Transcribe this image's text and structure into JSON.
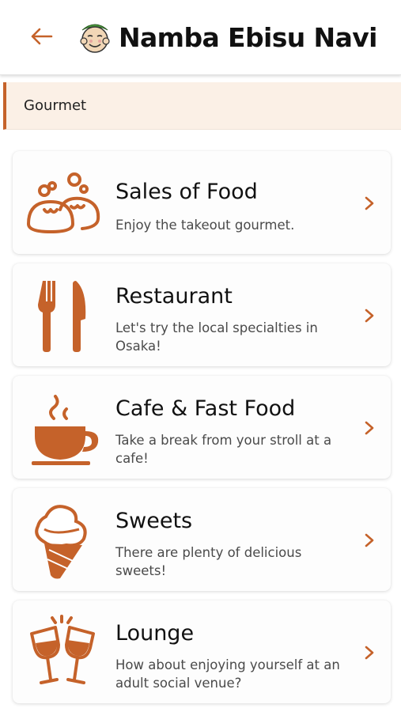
{
  "header": {
    "title": "Namba Ebisu Navi",
    "back_icon": "arrow-left-icon",
    "logo_icon": "ebisu-face-logo"
  },
  "section": {
    "title": "Gourmet"
  },
  "colors": {
    "accent": "#c5622a",
    "section_bg": "#fbf0e6",
    "card_bg": "#fdfdfd"
  },
  "categories": [
    {
      "title": "Sales of Food",
      "desc": "Enjoy the takeout gourmet.",
      "icon": "dumplings-icon"
    },
    {
      "title": "Restaurant",
      "desc": "Let's try the local specialties in Osaka!",
      "icon": "fork-knife-icon"
    },
    {
      "title": "Cafe & Fast Food",
      "desc": "Take a break from your stroll at a cafe!",
      "icon": "coffee-cup-icon"
    },
    {
      "title": "Sweets",
      "desc": "There are plenty of delicious sweets!",
      "icon": "ice-cream-icon"
    },
    {
      "title": "Lounge",
      "desc": "How about enjoying yourself at an adult social venue?",
      "icon": "wine-glasses-icon"
    }
  ]
}
